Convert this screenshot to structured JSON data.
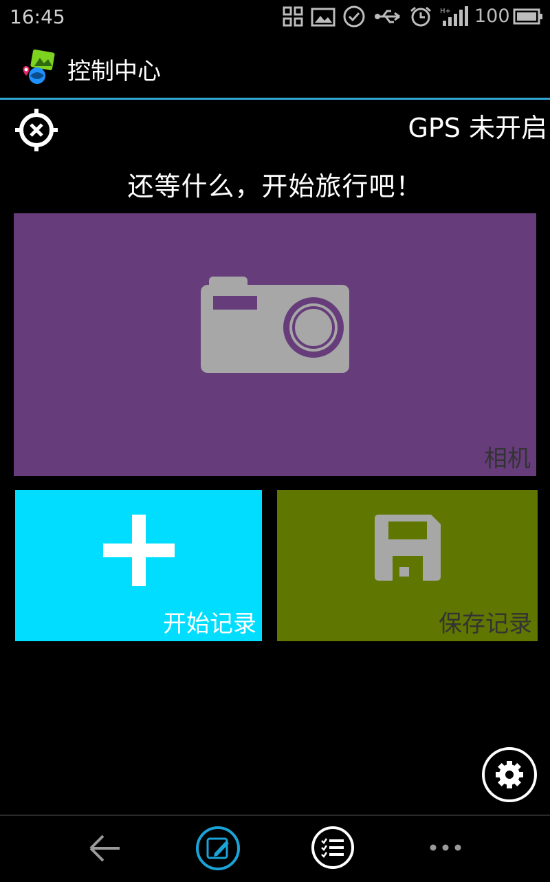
{
  "status_bar": {
    "time": "16:45",
    "battery_level": "100",
    "icons": [
      "qr-code-icon",
      "image-icon",
      "check-circle-icon",
      "usb-icon",
      "alarm-icon",
      "signal-hplus-icon",
      "battery-icon"
    ]
  },
  "action_bar": {
    "title": "控制中心",
    "app_icon": "app-logo-icon"
  },
  "gps": {
    "status_text": "GPS 未开启",
    "icon": "gps-off-crosshair-icon"
  },
  "headline": "还等什么，开始旅行吧！",
  "tiles": {
    "camera": {
      "label": "相机",
      "icon": "camera-icon",
      "color": "#663d7a"
    },
    "start_record": {
      "label": "开始记录",
      "icon": "plus-icon",
      "color": "#00ddff"
    },
    "save_record": {
      "label": "保存记录",
      "icon": "floppy-disk-icon",
      "color": "#5f7700"
    }
  },
  "settings": {
    "icon": "gear-icon"
  },
  "nav_bar": {
    "items": [
      "back-arrow-icon",
      "edit-note-icon",
      "checklist-icon",
      "more-dots-icon"
    ],
    "accent_color": "#1aa3d6"
  }
}
